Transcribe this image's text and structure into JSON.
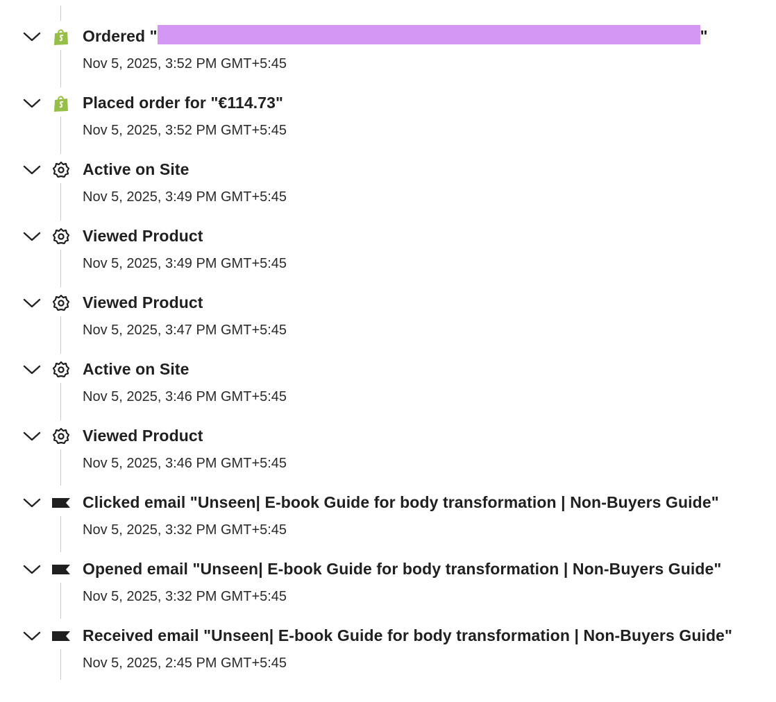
{
  "events": [
    {
      "title_prefix": "Ordered \"",
      "title_suffix": "\"",
      "redacted": true,
      "time": "Nov 5, 2025, 3:52 PM GMT+5:45",
      "icon": "shopify-bag-icon"
    },
    {
      "title": "Placed order for \"€114.73\"",
      "time": "Nov 5, 2025, 3:52 PM GMT+5:45",
      "icon": "shopify-bag-icon"
    },
    {
      "title": "Active on Site",
      "time": "Nov 5, 2025, 3:49 PM GMT+5:45",
      "icon": "gear-icon"
    },
    {
      "title": "Viewed Product",
      "time": "Nov 5, 2025, 3:49 PM GMT+5:45",
      "icon": "gear-icon"
    },
    {
      "title": "Viewed Product",
      "time": "Nov 5, 2025, 3:47 PM GMT+5:45",
      "icon": "gear-icon"
    },
    {
      "title": "Active on Site",
      "time": "Nov 5, 2025, 3:46 PM GMT+5:45",
      "icon": "gear-icon"
    },
    {
      "title": "Viewed Product",
      "time": "Nov 5, 2025, 3:46 PM GMT+5:45",
      "icon": "gear-icon"
    },
    {
      "title": "Clicked email \"Unseen| E-book Guide for body transformation | Non-Buyers Guide\"",
      "time": "Nov 5, 2025, 3:32 PM GMT+5:45",
      "icon": "email-flag-icon"
    },
    {
      "title": "Opened email \"Unseen| E-book Guide for body transformation | Non-Buyers Guide\"",
      "time": "Nov 5, 2025, 3:32 PM GMT+5:45",
      "icon": "email-flag-icon"
    },
    {
      "title": "Received email \"Unseen| E-book Guide for body transformation | Non-Buyers Guide\"",
      "time": "Nov 5, 2025, 2:45 PM GMT+5:45",
      "icon": "email-flag-icon"
    }
  ],
  "colors": {
    "shopify_green": "#95bf47",
    "redaction": "#d597f4",
    "timeline_line": "#c9c9c9"
  }
}
